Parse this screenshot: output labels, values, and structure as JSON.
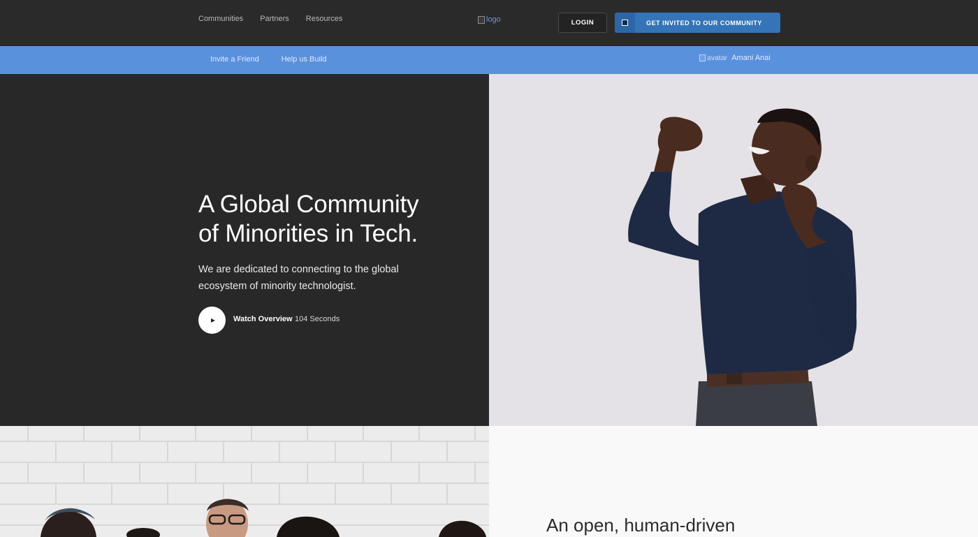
{
  "nav": {
    "links": [
      "Communities",
      "Partners",
      "Resources"
    ],
    "logo_alt": "logo",
    "login": "LOGIN",
    "cta": "GET INVITED TO OUR COMMUNITY"
  },
  "subnav": {
    "links": [
      "Invite a Friend",
      "Help us Build"
    ],
    "avatar_alt": "avatar",
    "user_name": "Amani Anai"
  },
  "hero": {
    "title_line1": "A Global Community",
    "title_line2": "of Minorities in Tech.",
    "subtitle_line1": "We are dedicated to connecting to the global",
    "subtitle_line2": "ecosystem of minority technologist.",
    "watch_label": "Watch Overview",
    "duration": "104 Seconds"
  },
  "section2": {
    "title": "An open, human-driven"
  },
  "colors": {
    "dark_bg": "#2a2a2b",
    "subnav_blue": "#5a91dd",
    "cta_blue": "#3574b7",
    "photo_bg": "#e4e2e6"
  }
}
